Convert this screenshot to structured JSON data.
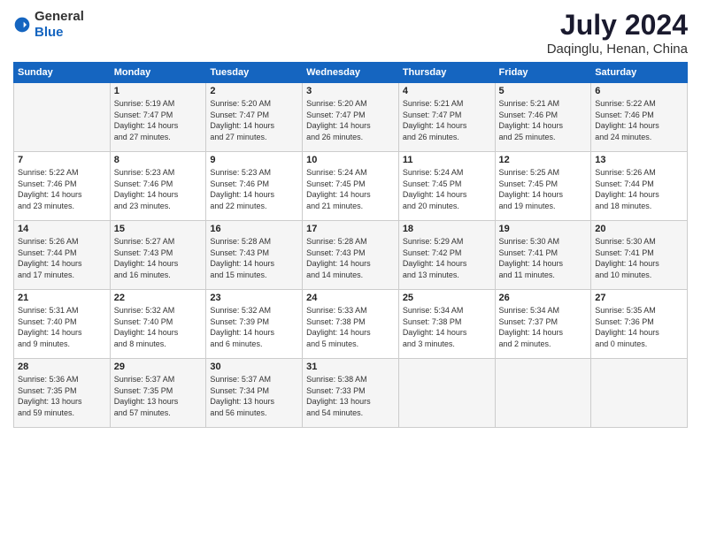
{
  "header": {
    "logo_general": "General",
    "logo_blue": "Blue",
    "title": "July 2024",
    "subtitle": "Daqinglu, Henan, China"
  },
  "days_of_week": [
    "Sunday",
    "Monday",
    "Tuesday",
    "Wednesday",
    "Thursday",
    "Friday",
    "Saturday"
  ],
  "weeks": [
    [
      {
        "day": "",
        "info": ""
      },
      {
        "day": "1",
        "info": "Sunrise: 5:19 AM\nSunset: 7:47 PM\nDaylight: 14 hours\nand 27 minutes."
      },
      {
        "day": "2",
        "info": "Sunrise: 5:20 AM\nSunset: 7:47 PM\nDaylight: 14 hours\nand 27 minutes."
      },
      {
        "day": "3",
        "info": "Sunrise: 5:20 AM\nSunset: 7:47 PM\nDaylight: 14 hours\nand 26 minutes."
      },
      {
        "day": "4",
        "info": "Sunrise: 5:21 AM\nSunset: 7:47 PM\nDaylight: 14 hours\nand 26 minutes."
      },
      {
        "day": "5",
        "info": "Sunrise: 5:21 AM\nSunset: 7:46 PM\nDaylight: 14 hours\nand 25 minutes."
      },
      {
        "day": "6",
        "info": "Sunrise: 5:22 AM\nSunset: 7:46 PM\nDaylight: 14 hours\nand 24 minutes."
      }
    ],
    [
      {
        "day": "7",
        "info": "Sunrise: 5:22 AM\nSunset: 7:46 PM\nDaylight: 14 hours\nand 23 minutes."
      },
      {
        "day": "8",
        "info": "Sunrise: 5:23 AM\nSunset: 7:46 PM\nDaylight: 14 hours\nand 23 minutes."
      },
      {
        "day": "9",
        "info": "Sunrise: 5:23 AM\nSunset: 7:46 PM\nDaylight: 14 hours\nand 22 minutes."
      },
      {
        "day": "10",
        "info": "Sunrise: 5:24 AM\nSunset: 7:45 PM\nDaylight: 14 hours\nand 21 minutes."
      },
      {
        "day": "11",
        "info": "Sunrise: 5:24 AM\nSunset: 7:45 PM\nDaylight: 14 hours\nand 20 minutes."
      },
      {
        "day": "12",
        "info": "Sunrise: 5:25 AM\nSunset: 7:45 PM\nDaylight: 14 hours\nand 19 minutes."
      },
      {
        "day": "13",
        "info": "Sunrise: 5:26 AM\nSunset: 7:44 PM\nDaylight: 14 hours\nand 18 minutes."
      }
    ],
    [
      {
        "day": "14",
        "info": "Sunrise: 5:26 AM\nSunset: 7:44 PM\nDaylight: 14 hours\nand 17 minutes."
      },
      {
        "day": "15",
        "info": "Sunrise: 5:27 AM\nSunset: 7:43 PM\nDaylight: 14 hours\nand 16 minutes."
      },
      {
        "day": "16",
        "info": "Sunrise: 5:28 AM\nSunset: 7:43 PM\nDaylight: 14 hours\nand 15 minutes."
      },
      {
        "day": "17",
        "info": "Sunrise: 5:28 AM\nSunset: 7:43 PM\nDaylight: 14 hours\nand 14 minutes."
      },
      {
        "day": "18",
        "info": "Sunrise: 5:29 AM\nSunset: 7:42 PM\nDaylight: 14 hours\nand 13 minutes."
      },
      {
        "day": "19",
        "info": "Sunrise: 5:30 AM\nSunset: 7:41 PM\nDaylight: 14 hours\nand 11 minutes."
      },
      {
        "day": "20",
        "info": "Sunrise: 5:30 AM\nSunset: 7:41 PM\nDaylight: 14 hours\nand 10 minutes."
      }
    ],
    [
      {
        "day": "21",
        "info": "Sunrise: 5:31 AM\nSunset: 7:40 PM\nDaylight: 14 hours\nand 9 minutes."
      },
      {
        "day": "22",
        "info": "Sunrise: 5:32 AM\nSunset: 7:40 PM\nDaylight: 14 hours\nand 8 minutes."
      },
      {
        "day": "23",
        "info": "Sunrise: 5:32 AM\nSunset: 7:39 PM\nDaylight: 14 hours\nand 6 minutes."
      },
      {
        "day": "24",
        "info": "Sunrise: 5:33 AM\nSunset: 7:38 PM\nDaylight: 14 hours\nand 5 minutes."
      },
      {
        "day": "25",
        "info": "Sunrise: 5:34 AM\nSunset: 7:38 PM\nDaylight: 14 hours\nand 3 minutes."
      },
      {
        "day": "26",
        "info": "Sunrise: 5:34 AM\nSunset: 7:37 PM\nDaylight: 14 hours\nand 2 minutes."
      },
      {
        "day": "27",
        "info": "Sunrise: 5:35 AM\nSunset: 7:36 PM\nDaylight: 14 hours\nand 0 minutes."
      }
    ],
    [
      {
        "day": "28",
        "info": "Sunrise: 5:36 AM\nSunset: 7:35 PM\nDaylight: 13 hours\nand 59 minutes."
      },
      {
        "day": "29",
        "info": "Sunrise: 5:37 AM\nSunset: 7:35 PM\nDaylight: 13 hours\nand 57 minutes."
      },
      {
        "day": "30",
        "info": "Sunrise: 5:37 AM\nSunset: 7:34 PM\nDaylight: 13 hours\nand 56 minutes."
      },
      {
        "day": "31",
        "info": "Sunrise: 5:38 AM\nSunset: 7:33 PM\nDaylight: 13 hours\nand 54 minutes."
      },
      {
        "day": "",
        "info": ""
      },
      {
        "day": "",
        "info": ""
      },
      {
        "day": "",
        "info": ""
      }
    ]
  ]
}
